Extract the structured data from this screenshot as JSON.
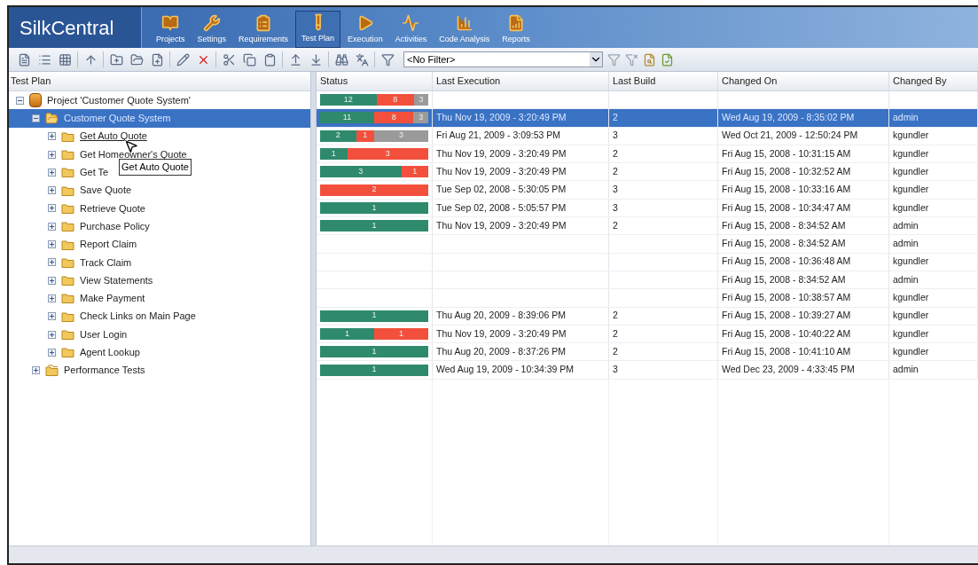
{
  "app": {
    "logo": "SilkCentral"
  },
  "nav": [
    {
      "label": "Projects",
      "selected": false
    },
    {
      "label": "Settings",
      "selected": false
    },
    {
      "label": "Requirements",
      "selected": false
    },
    {
      "label": "Test Plan",
      "selected": true
    },
    {
      "label": "Execution",
      "selected": false
    },
    {
      "label": "Activities",
      "selected": false
    },
    {
      "label": "Code Analysis",
      "selected": false
    },
    {
      "label": "Reports",
      "selected": false
    }
  ],
  "toolbar": {
    "filter": {
      "value": "<No Filter>"
    }
  },
  "tree": {
    "heading": "Test Plan",
    "items": [
      {
        "label": "Project 'Customer Quote System'",
        "kind": "project",
        "expanded": true,
        "selected": false,
        "children": [
          {
            "label": "Customer Quote System",
            "kind": "open-folder",
            "expanded": true,
            "selected": true,
            "children": [
              {
                "label": "Get Auto Quote",
                "kind": "folder",
                "expanded": false,
                "selected": false,
                "hovered": true
              },
              {
                "label": "Get Homeowner's Quote",
                "kind": "folder",
                "expanded": false,
                "selected": false
              },
              {
                "label": "Get Te",
                "kind": "folder",
                "expanded": false,
                "selected": false
              },
              {
                "label": "Save Quote",
                "kind": "folder",
                "expanded": false,
                "selected": false
              },
              {
                "label": "Retrieve Quote",
                "kind": "folder",
                "expanded": false,
                "selected": false
              },
              {
                "label": "Purchase Policy",
                "kind": "folder",
                "expanded": false,
                "selected": false
              },
              {
                "label": "Report Claim",
                "kind": "folder",
                "expanded": false,
                "selected": false
              },
              {
                "label": "Track Claim",
                "kind": "folder",
                "expanded": false,
                "selected": false
              },
              {
                "label": "View Statements",
                "kind": "folder",
                "expanded": false,
                "selected": false
              },
              {
                "label": "Make Payment",
                "kind": "folder",
                "expanded": false,
                "selected": false
              },
              {
                "label": "Check Links on Main Page",
                "kind": "folder",
                "expanded": false,
                "selected": false
              },
              {
                "label": "User Login",
                "kind": "folder",
                "expanded": false,
                "selected": false
              },
              {
                "label": "Agent Lookup",
                "kind": "folder",
                "expanded": false,
                "selected": false
              }
            ]
          },
          {
            "label": "Performance Tests",
            "kind": "package",
            "expanded": false,
            "selected": false
          }
        ]
      }
    ]
  },
  "tooltip": {
    "text": "Get Auto Quote"
  },
  "grid": {
    "columns": [
      "Status",
      "Last Execution",
      "Last Build",
      "Changed On",
      "Changed By"
    ],
    "rows": [
      {
        "selected": false,
        "status": [
          {
            "kind": "passed",
            "count": "12"
          },
          {
            "kind": "failed",
            "count": "8"
          },
          {
            "kind": "not-run",
            "count": "3"
          }
        ],
        "last_execution": "",
        "last_build": "",
        "changed_on": "",
        "changed_by": ""
      },
      {
        "selected": true,
        "status": [
          {
            "kind": "passed",
            "count": "11"
          },
          {
            "kind": "failed",
            "count": "8"
          },
          {
            "kind": "not-run",
            "count": "3"
          }
        ],
        "last_execution": "Thu Nov 19, 2009 - 3:20:49 PM",
        "last_build": "2",
        "changed_on": "Wed Aug 19, 2009 - 8:35:02 PM",
        "changed_by": "admin"
      },
      {
        "selected": false,
        "status": [
          {
            "kind": "passed",
            "count": "2"
          },
          {
            "kind": "failed",
            "count": "1"
          },
          {
            "kind": "not-run",
            "count": "3"
          }
        ],
        "last_execution": "Fri Aug 21, 2009 - 3:09:53 PM",
        "last_build": "3",
        "changed_on": "Wed Oct 21, 2009 - 12:50:24 PM",
        "changed_by": "kgundler"
      },
      {
        "selected": false,
        "status": [
          {
            "kind": "passed",
            "count": "1"
          },
          {
            "kind": "failed",
            "count": "3"
          }
        ],
        "last_execution": "Thu Nov 19, 2009 - 3:20:49 PM",
        "last_build": "2",
        "changed_on": "Fri Aug 15, 2008 - 10:31:15 AM",
        "changed_by": "kgundler"
      },
      {
        "selected": false,
        "status": [
          {
            "kind": "passed",
            "count": "3"
          },
          {
            "kind": "failed",
            "count": "1"
          }
        ],
        "last_execution": "Thu Nov 19, 2009 - 3:20:49 PM",
        "last_build": "2",
        "changed_on": "Fri Aug 15, 2008 - 10:32:52 AM",
        "changed_by": "kgundler"
      },
      {
        "selected": false,
        "status": [
          {
            "kind": "failed",
            "count": "2"
          }
        ],
        "last_execution": "Tue Sep 02, 2008 - 5:30:05 PM",
        "last_build": "3",
        "changed_on": "Fri Aug 15, 2008 - 10:33:16 AM",
        "changed_by": "kgundler"
      },
      {
        "selected": false,
        "status": [
          {
            "kind": "passed",
            "count": "1"
          }
        ],
        "last_execution": "Tue Sep 02, 2008 - 5:05:57 PM",
        "last_build": "3",
        "changed_on": "Fri Aug 15, 2008 - 10:34:47 AM",
        "changed_by": "kgundler"
      },
      {
        "selected": false,
        "status": [
          {
            "kind": "passed",
            "count": "1"
          }
        ],
        "last_execution": "Thu Nov 19, 2009 - 3:20:49 PM",
        "last_build": "2",
        "changed_on": "Fri Aug 15, 2008 - 8:34:52 AM",
        "changed_by": "admin"
      },
      {
        "selected": false,
        "status": [],
        "last_execution": "",
        "last_build": "",
        "changed_on": "Fri Aug 15, 2008 - 8:34:52 AM",
        "changed_by": "admin"
      },
      {
        "selected": false,
        "status": [],
        "last_execution": "",
        "last_build": "",
        "changed_on": "Fri Aug 15, 2008 - 10:36:48 AM",
        "changed_by": "kgundler"
      },
      {
        "selected": false,
        "status": [],
        "last_execution": "",
        "last_build": "",
        "changed_on": "Fri Aug 15, 2008 - 8:34:52 AM",
        "changed_by": "admin"
      },
      {
        "selected": false,
        "status": [],
        "last_execution": "",
        "last_build": "",
        "changed_on": "Fri Aug 15, 2008 - 10:38:57 AM",
        "changed_by": "kgundler"
      },
      {
        "selected": false,
        "status": [
          {
            "kind": "passed",
            "count": "1"
          }
        ],
        "last_execution": "Thu Aug 20, 2009 - 8:39:06 PM",
        "last_build": "2",
        "changed_on": "Fri Aug 15, 2008 - 10:39:27 AM",
        "changed_by": "kgundler"
      },
      {
        "selected": false,
        "status": [
          {
            "kind": "passed",
            "count": "1"
          },
          {
            "kind": "failed",
            "count": "1"
          }
        ],
        "last_execution": "Thu Nov 19, 2009 - 3:20:49 PM",
        "last_build": "2",
        "changed_on": "Fri Aug 15, 2008 - 10:40:22 AM",
        "changed_by": "kgundler"
      },
      {
        "selected": false,
        "status": [
          {
            "kind": "passed",
            "count": "1"
          }
        ],
        "last_execution": "Thu Aug 20, 2009 - 8:37:26 PM",
        "last_build": "2",
        "changed_on": "Fri Aug 15, 2008 - 10:41:10 AM",
        "changed_by": "kgundler"
      },
      {
        "selected": false,
        "status": [
          {
            "kind": "passed",
            "count": "1"
          }
        ],
        "last_execution": "Wed Aug 19, 2009 - 10:34:39 PM",
        "last_build": "3",
        "changed_on": "Wed Dec 23, 2009 - 4:33:45 PM",
        "changed_by": "admin"
      }
    ]
  }
}
